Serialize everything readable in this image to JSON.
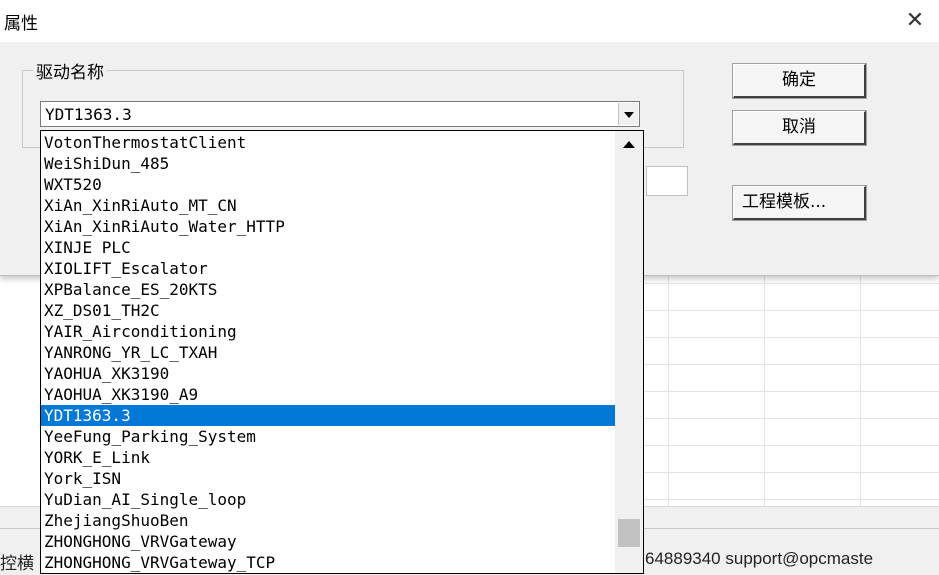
{
  "dialog": {
    "title": "属性",
    "close_glyph": "✕",
    "group_label": "驱动名称",
    "combo_value": "YDT1363.3",
    "ok_label": "确定",
    "cancel_label": "取消",
    "template_label": "工程模板..."
  },
  "dropdown": {
    "items": [
      "VotonThermostatClient",
      "WeiShiDun_485",
      "WXT520",
      "XiAn_XinRiAuto_MT_CN",
      "XiAn_XinRiAuto_Water_HTTP",
      "XINJE PLC",
      "XIOLIFT_Escalator",
      "XPBalance_ES_20KTS",
      "XZ_DS01_TH2C",
      "YAIR_Airconditioning",
      "YANRONG_YR_LC_TXAH",
      "YAOHUA_XK3190",
      "YAOHUA_XK3190_A9",
      "YDT1363.3",
      "YeeFung_Parking_System",
      "YORK_E_Link",
      "York_ISN",
      "YuDian_AI_Single_loop",
      "ZhejiangShuoBen",
      "ZHONGHONG_VRVGateway",
      "ZHONGHONG_VRVGateway_TCP"
    ],
    "selected": "YDT1363.3"
  },
  "statusbar": {
    "left_text": "控横",
    "right_text": "64889340 support@opcmaste",
    "chevron_glyph": "∨"
  },
  "icons": {
    "close": "close-icon",
    "combo_arrow": "chevron-down-icon",
    "scroll_up": "chevron-up-icon"
  },
  "colors": {
    "selection": "#0078d7",
    "dialog_bg": "#f0f0f0"
  }
}
